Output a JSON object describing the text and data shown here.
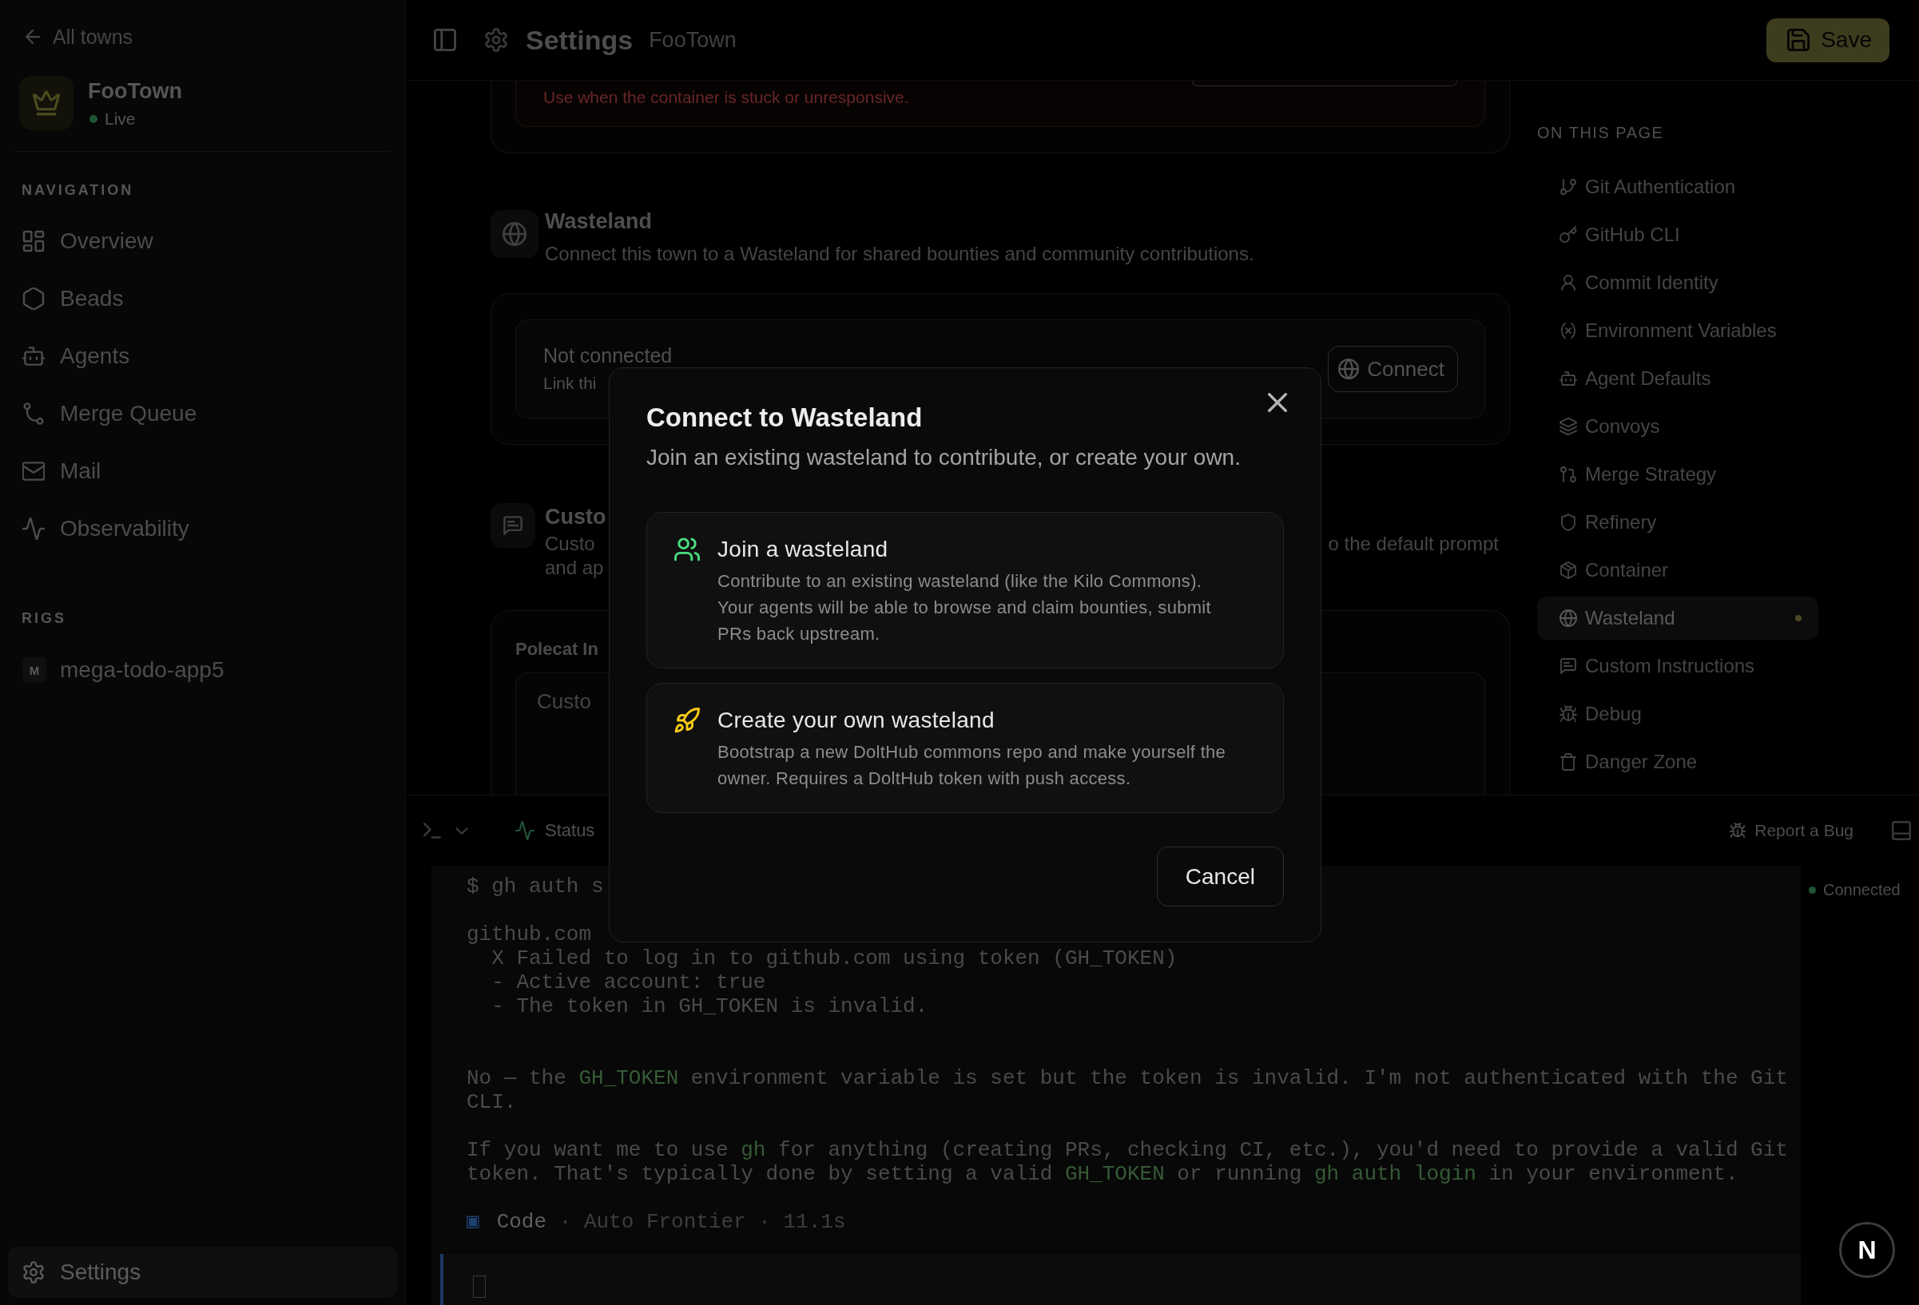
{
  "sidebar": {
    "back_link": "All towns",
    "town": {
      "name": "FooTown",
      "status": "Live"
    },
    "nav_heading": "NAVIGATION",
    "nav_items": [
      {
        "label": "Overview",
        "selected": false
      },
      {
        "label": "Beads",
        "selected": false
      },
      {
        "label": "Agents",
        "selected": false
      },
      {
        "label": "Merge Queue",
        "selected": false
      },
      {
        "label": "Mail",
        "selected": false
      },
      {
        "label": "Observability",
        "selected": false
      }
    ],
    "rigs_heading": "RIGS",
    "rigs": [
      {
        "initial": "M",
        "name": "mega-todo-app5"
      }
    ],
    "settings_item": {
      "label": "Settings",
      "selected": true
    }
  },
  "topbar": {
    "title": "Settings",
    "subtitle": "FooTown",
    "save_button": "Save"
  },
  "settings": {
    "danger_card": {
      "note": "Use when the container is stuck or unresponsive."
    },
    "wasteland": {
      "title": "Wasteland",
      "description": "Connect this town to a Wasteland for shared bounties and community contributions.",
      "status_title": "Not connected",
      "status_detail": "Link thi",
      "connect_button": "Connect"
    },
    "custom_instructions": {
      "title": "Custo",
      "description_start": "Custo",
      "description_end": "o the default prompt",
      "description_line_2": "and ap"
    },
    "polecat_card": {
      "label": "Polecat In",
      "placeholder": "Custo"
    }
  },
  "on_this_page": {
    "heading": "ON THIS PAGE",
    "items": [
      {
        "label": "Git Authentication",
        "selected": false
      },
      {
        "label": "GitHub CLI",
        "selected": false
      },
      {
        "label": "Commit Identity",
        "selected": false
      },
      {
        "label": "Environment Variables",
        "selected": false
      },
      {
        "label": "Agent Defaults",
        "selected": false
      },
      {
        "label": "Convoys",
        "selected": false
      },
      {
        "label": "Merge Strategy",
        "selected": false
      },
      {
        "label": "Refinery",
        "selected": false
      },
      {
        "label": "Container",
        "selected": false
      },
      {
        "label": "Wasteland",
        "selected": true
      },
      {
        "label": "Custom Instructions",
        "selected": false
      },
      {
        "label": "Debug",
        "selected": false
      },
      {
        "label": "Danger Zone",
        "selected": false
      }
    ]
  },
  "terminal": {
    "status_tab": "Status",
    "report_bug": "Report a Bug",
    "blocks": [
      {
        "kind": "command",
        "lines": [
          [
            {
              "kind": "plain",
              "text": "$ gh auth s"
            }
          ]
        ]
      },
      {
        "kind": "output",
        "lines": [
          [
            {
              "kind": "plain",
              "text": "github.com"
            }
          ],
          [
            {
              "kind": "plain",
              "text": "  X Failed to log in to github.com using token (GH_TOKEN)"
            }
          ],
          [
            {
              "kind": "plain",
              "text": "  - Active account: true"
            }
          ],
          [
            {
              "kind": "plain",
              "text": "  - The token in GH_TOKEN is invalid."
            }
          ]
        ]
      },
      {
        "kind": "message",
        "lines": [
          [
            {
              "kind": "plain",
              "text": "No — the "
            },
            {
              "kind": "code",
              "text": "GH_TOKEN"
            },
            {
              "kind": "plain",
              "text": " environment variable is set but the token is invalid. I'm not authenticated with the Git"
            }
          ],
          [
            {
              "kind": "plain",
              "text": "CLI."
            }
          ]
        ]
      },
      {
        "kind": "message",
        "lines": [
          [
            {
              "kind": "plain",
              "text": "If you want me to use "
            },
            {
              "kind": "code",
              "text": "gh"
            },
            {
              "kind": "plain",
              "text": " for anything (creating PRs, checking CI, etc.), you'd need to provide a valid Git"
            }
          ],
          [
            {
              "kind": "plain",
              "text": "token. That's typically done by setting a valid "
            },
            {
              "kind": "code",
              "text": "GH_TOKEN"
            },
            {
              "kind": "plain",
              "text": " or running "
            },
            {
              "kind": "code",
              "text": "gh auth login"
            },
            {
              "kind": "plain",
              "text": " in your environment."
            }
          ]
        ]
      }
    ],
    "footer": {
      "mark": "▣",
      "mode": "Code",
      "detail": "· Auto Frontier · 11.1s"
    },
    "connection": "Connected"
  },
  "modal": {
    "title": "Connect to Wasteland",
    "subtitle": "Join an existing wasteland to contribute, or create your own.",
    "options": [
      {
        "title": "Join a wasteland",
        "description": "Contribute to an existing wasteland (like the Kilo Commons). Your agents will be able to browse and claim bounties, submit PRs back upstream."
      },
      {
        "title": "Create your own wasteland",
        "description": "Bootstrap a new DoltHub commons repo and make yourself the owner. Requires a DoltHub token with push access."
      }
    ],
    "cancel_button": "Cancel"
  },
  "dev_badge": {
    "label": "N"
  }
}
